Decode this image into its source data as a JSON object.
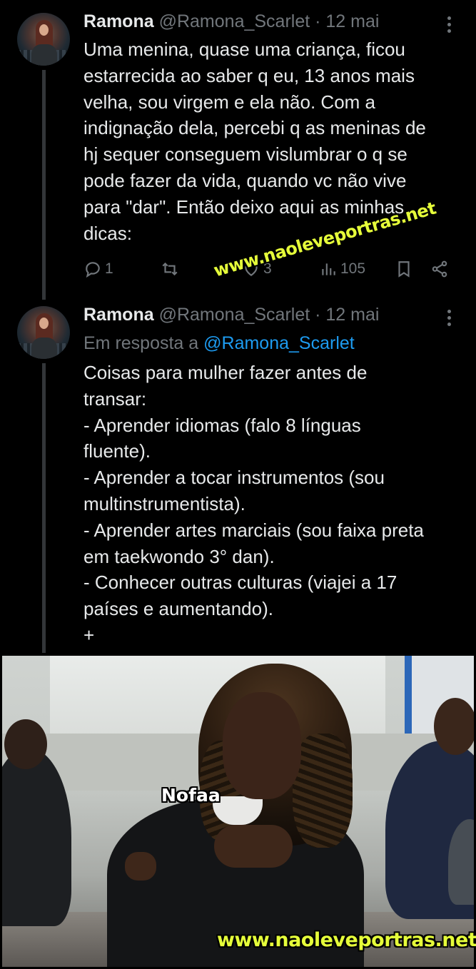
{
  "tweets": [
    {
      "name": "Ramona",
      "handle": "@Ramona_Scarlet · 12 mai",
      "text": "Uma menina, quase uma criança, ficou\nestarrecida ao saber q eu, 13 anos mais\nvelha, sou virgem e ela não. Com a\nindignação dela, percebi q as meninas de\nhj sequer conseguem vislumbrar o q se\npode fazer da vida, quando vc não vive\npara \"dar\".  Então deixo aqui as minhas\ndicas:",
      "actions": {
        "reply_icon": "reply-icon",
        "reply_count": "1",
        "retweet_icon": "retweet-icon",
        "like_icon": "heart-icon",
        "like_count": "3",
        "views_icon": "views-icon",
        "views_count": "105",
        "bookmark_icon": "bookmark-icon",
        "share_icon": "share-icon"
      }
    },
    {
      "name": "Ramona",
      "handle": "@Ramona_Scarlet · 12 mai",
      "reply_prefix": "Em resposta a",
      "reply_mention": "@Ramona_Scarlet",
      "text": "Coisas para mulher fazer antes de\ntransar:\n- Aprender idiomas (falo 8 línguas\nfluente).\n- Aprender a tocar instrumentos (sou\nmultinstrumentista).\n- Aprender artes marciais (sou faixa preta\nem taekwondo 3° dan).\n- Conhecer outras culturas (viajei a 17\npaíses e aumentando).\n+"
    }
  ],
  "meme": {
    "label": "Nofaa"
  },
  "watermark": {
    "top": "www.naoleveportras.net",
    "bottom": "www.naoleveportras.net",
    "color": "#e6ff3a"
  },
  "colors": {
    "background": "#000000",
    "text": "#e7e9ea",
    "muted": "#71767b",
    "link": "#1d9bf0"
  }
}
